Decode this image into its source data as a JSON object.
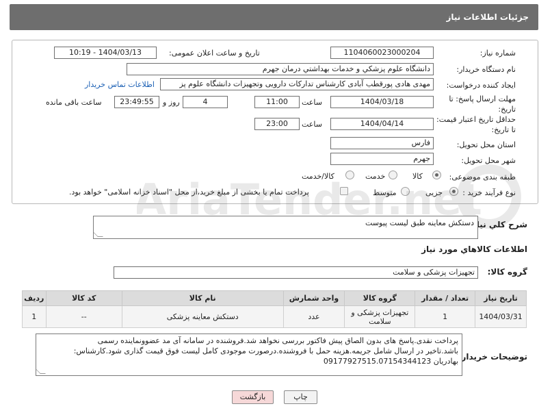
{
  "header": {
    "title": "جزئیات اطلاعات نیاز"
  },
  "form": {
    "need_number": {
      "label": "شماره نیاز:",
      "value": "1104060023000204"
    },
    "announce": {
      "label": "تاریخ و ساعت اعلان عمومی:",
      "value": "1404/03/13 - 10:19"
    },
    "buyer_org": {
      "label": "نام دستگاه خریدار:",
      "value": "دانشگاه علوم پزشکي و خدمات بهداشتي  درمان جهرم"
    },
    "creator": {
      "label": "ایجاد کننده درخواست:",
      "value": "مهدی هادی پورقطب آبادی کارشناس تدارکات دارویی وتجهیزات دانشگاه علوم پز",
      "contact_link": "اطلاعات تماس خریدار"
    },
    "deadline": {
      "label": "مهلت ارسال پاسخ: تا تاریخ:",
      "date": "1404/03/18",
      "time_label": "ساعت",
      "time": "11:00",
      "days": "4",
      "days_label": "روز و",
      "remaining": "23:49:55",
      "remaining_label": "ساعت باقی مانده"
    },
    "min_validity": {
      "label": "حداقل تاریخ اعتبار قیمت: تا تاریخ:",
      "date": "1404/04/14",
      "time_label": "ساعت",
      "time": "23:00"
    },
    "province": {
      "label": "استان محل تحویل:",
      "value": "فارس"
    },
    "city": {
      "label": "شهر محل تحویل:",
      "value": "جهرم"
    },
    "category": {
      "label": "طبقه بندی موضوعی:",
      "options": [
        "کالا",
        "خدمت",
        "کالا/خدمت"
      ],
      "selected": "کالا"
    },
    "purchase_type": {
      "label": "نوع فرآیند خرید :",
      "options": [
        "جزیی",
        "متوسط"
      ],
      "selected": "جزیی",
      "note": "پرداخت تمام یا بخشی از مبلغ خرید،از محل \"اسناد خزانه اسلامی\" خواهد بود."
    }
  },
  "need_description": {
    "label": "شرح کلي نياز:",
    "value": "دستکش معاینه طبق لیست پیوست"
  },
  "goods_section": {
    "title": "اطلاعات کالاهاي مورد نياز"
  },
  "goods_group": {
    "label": "گروه کالا:",
    "value": "تجهیزات پزشکی و سلامت"
  },
  "table": {
    "headers": [
      "ردیف",
      "کد کالا",
      "نام کالا",
      "واحد شمارش",
      "گروه کالا",
      "تعداد / مقدار",
      "تاریخ نیاز"
    ],
    "rows": [
      [
        "1",
        "--",
        "دستکش معاینه پزشکی",
        "عدد",
        "تجهیزات پزشکی و سلامت",
        "1",
        "1404/03/31"
      ]
    ]
  },
  "buyer_notes": {
    "label": "توضیحات خریدار:",
    "lines": [
      "پرداخت نقدی.پاسخ های بدون الصاق پیش فاکتور بررسی نخواهد شد.فروشنده در سامانه آی مد عضوونماینده رسمی",
      "باشد.تاخیر در ارسال شامل جریمه.هزینه حمل با فروشنده.درصورت موجودی کامل لیست فوق قیمت گذاری شود.کارشناس:",
      "بهادریان 09177927515.07154344123"
    ]
  },
  "buttons": {
    "print": "چاپ",
    "back": "بازگشت"
  },
  "watermark": {
    "text": "AriaTender.net"
  },
  "colors": {
    "header_bg": "#6e6e6e",
    "link": "#1a5fb4",
    "back_button_bg": "#f6d8d8"
  }
}
